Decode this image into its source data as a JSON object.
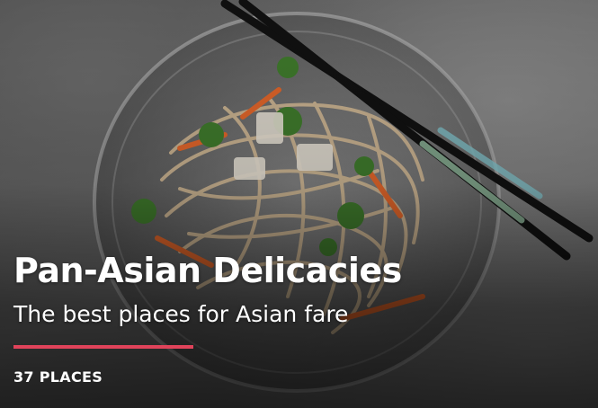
{
  "card": {
    "title": "Pan-Asian Delicacies",
    "subtitle": "The best places for Asian fare",
    "count_label": "37 PLACES",
    "accent_color": "#e0435a",
    "image_icon": "noodle-bowl-photo"
  }
}
